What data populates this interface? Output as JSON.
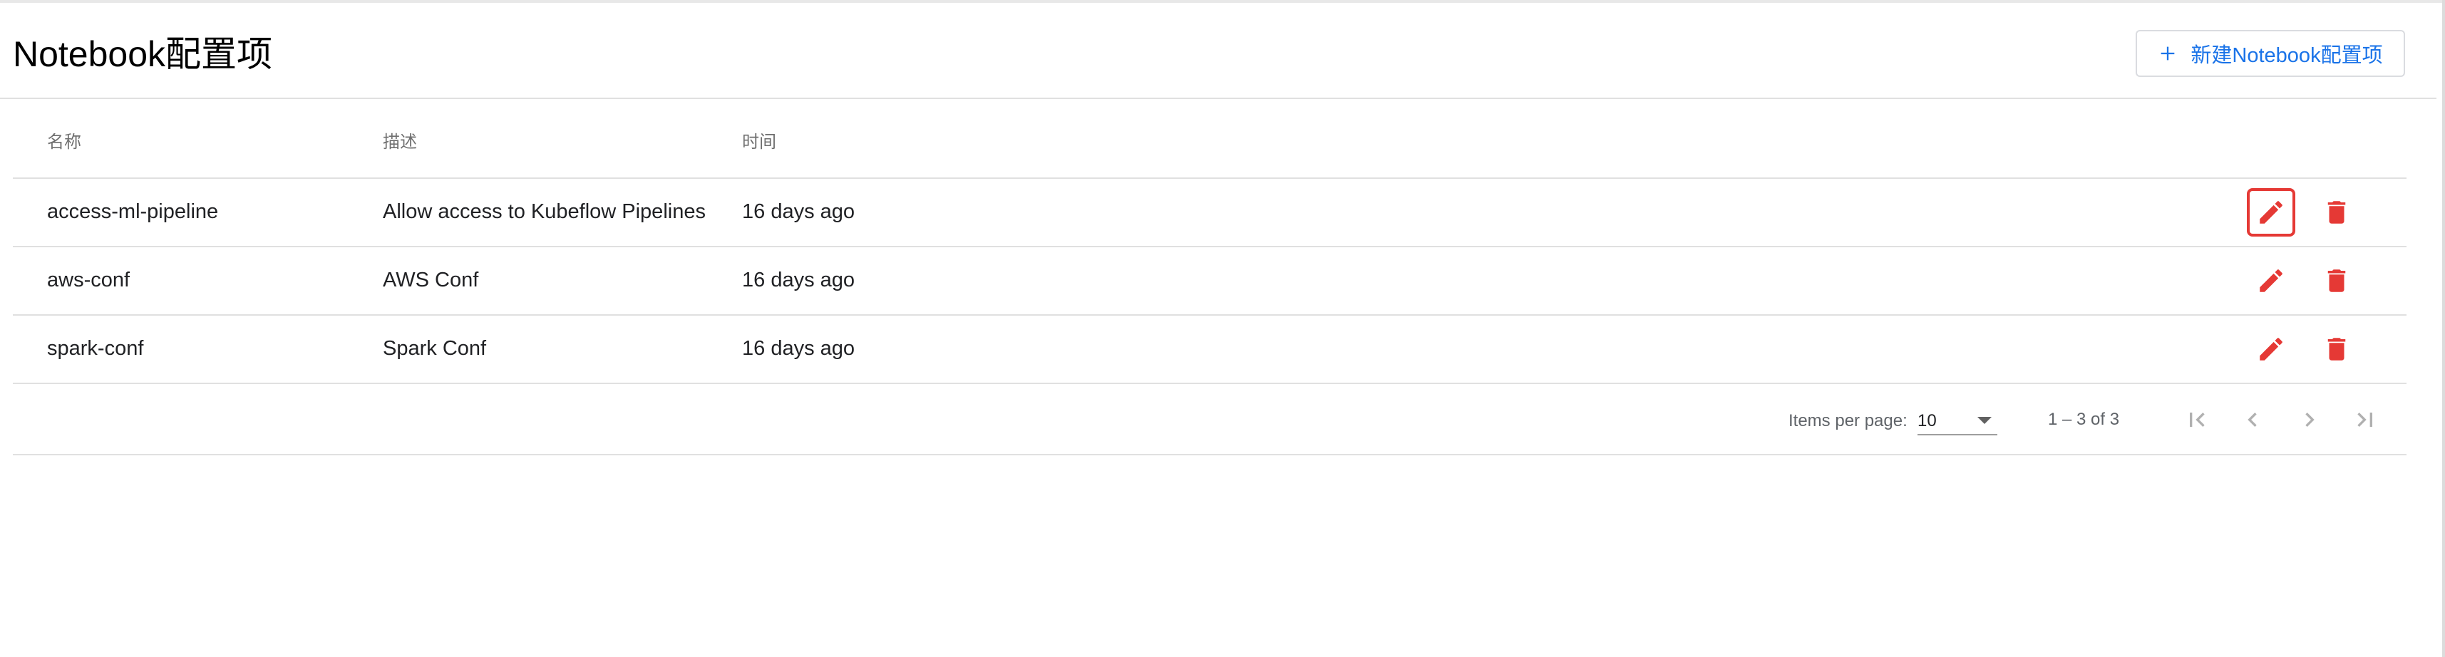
{
  "header": {
    "title": "Notebook配置项",
    "new_button_label": "新建Notebook配置项"
  },
  "table": {
    "columns": [
      "名称",
      "描述",
      "时间"
    ],
    "rows": [
      {
        "name": "access-ml-pipeline",
        "description": "Allow access to Kubeflow Pipelines",
        "time": "16 days ago"
      },
      {
        "name": "aws-conf",
        "description": "AWS Conf",
        "time": "16 days ago"
      },
      {
        "name": "spark-conf",
        "description": "Spark Conf",
        "time": "16 days ago"
      }
    ]
  },
  "paginator": {
    "items_per_page_label": "Items per page:",
    "items_per_page_value": "10",
    "range_label": "1 – 3 of 3"
  },
  "icons": {
    "add": "plus-icon",
    "edit": "pencil-icon",
    "delete": "trash-icon",
    "first": "first-page-icon",
    "prev": "chevron-left-icon",
    "next": "chevron-right-icon",
    "last": "last-page-icon"
  },
  "colors": {
    "accent": "#1a73e8",
    "danger": "#e53935"
  }
}
